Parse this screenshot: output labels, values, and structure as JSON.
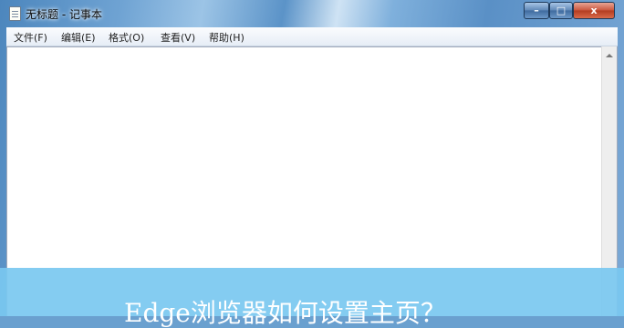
{
  "window": {
    "title": "无标题 - 记事本",
    "controls": {
      "minimize": "–",
      "maximize": "□",
      "close": "x"
    }
  },
  "menu": {
    "items": [
      {
        "label": "文件(F)"
      },
      {
        "label": "编辑(E)"
      },
      {
        "label": "格式(O)"
      },
      {
        "label": "查看(V)"
      },
      {
        "label": "帮助(H)"
      }
    ]
  },
  "editor": {
    "content": ""
  },
  "overlay": {
    "caption": "Edge浏览器如何设置主页？"
  },
  "colors": {
    "overlay": "#7ac8f0",
    "frame": "#6fa3d3",
    "close": "#c9553c"
  }
}
